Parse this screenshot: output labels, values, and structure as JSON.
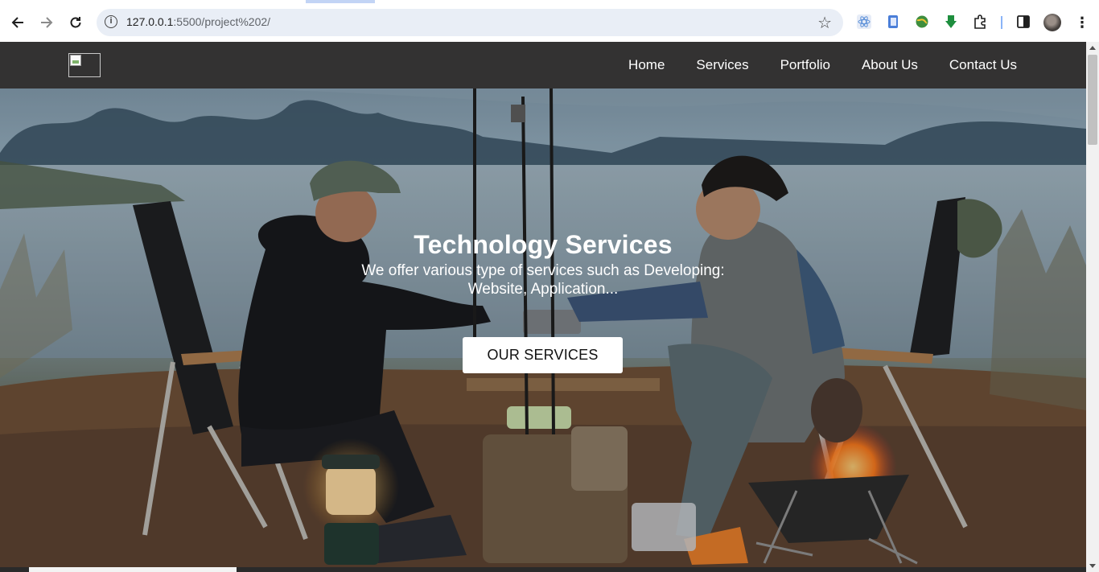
{
  "browser": {
    "url_host": "127.0.0.1",
    "url_rest": ":5500/project%202/",
    "icons": {
      "back": "arrow-left-icon",
      "forward": "arrow-right-icon",
      "reload": "reload-icon",
      "info": "info-icon",
      "bookmark": "star-icon",
      "menu": "kebab-menu-icon"
    }
  },
  "site": {
    "nav": {
      "items": [
        {
          "label": "Home"
        },
        {
          "label": "Services"
        },
        {
          "label": "Portfolio"
        },
        {
          "label": "About Us"
        },
        {
          "label": "Contact Us"
        }
      ]
    },
    "hero": {
      "title": "Technology Services",
      "subtitle": "We offer various type of services such as Developing: Website, Application...",
      "cta_label": "OUR SERVICES"
    }
  },
  "colors": {
    "nav_bg": "#333232",
    "browser_frame": "#d3e3fd",
    "cta_bg": "#ffffff"
  }
}
